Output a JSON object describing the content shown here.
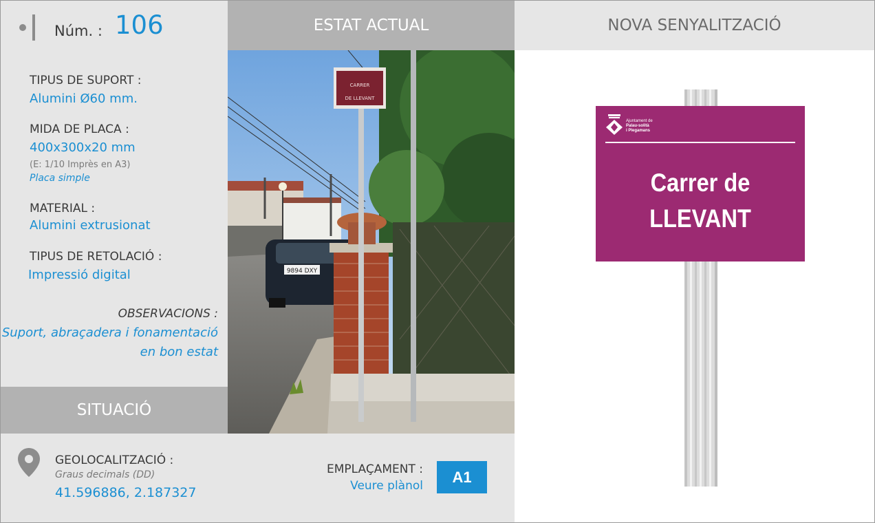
{
  "header": {
    "num_label": "Núm. :",
    "num_value": "106",
    "estat_title": "ESTAT ACTUAL",
    "nova_title": "NOVA SENYALITZACIÓ"
  },
  "info": {
    "suport_label": "TIPUS DE SUPORT :",
    "suport_value": "Alumini Ø60 mm.",
    "mida_label": "MIDA DE PLACA :",
    "mida_value": "400x300x20 mm",
    "mida_scale": "(E: 1/10 Imprès en A3)",
    "mida_type": "Placa simple",
    "material_label": "MATERIAL :",
    "material_value": "Alumini extrusionat",
    "retolacio_label": "TIPUS DE RETOLACIÓ :",
    "retolacio_value": "Impressió digital",
    "observacions_label": "OBSERVACIONS :",
    "observacions_value": "Suport, abraçadera i fonamentació en bon estat"
  },
  "situacio": {
    "title": "SITUACIÓ",
    "geo_label": "GEOLOCALITZACIÓ :",
    "geo_sub": "Graus decimals (DD)",
    "geo_value": "41.596886, 2.187327",
    "emp_label": "EMPLAÇAMENT :",
    "emp_value": "Veure plànol",
    "emp_code": "A1"
  },
  "photo": {
    "sign_line1": "CARRER",
    "sign_line2": "DE LLEVANT",
    "plate_number": "9894 DXY"
  },
  "new_sign": {
    "org_line1": "Ajuntament de",
    "org_line2": "Palau-solità",
    "org_line3": "i Plegamans",
    "text_line1": "Carrer de",
    "text_line2": "LLEVANT",
    "plate_color": "#9c2a72"
  },
  "colors": {
    "accent": "#1b8fd2",
    "header_dark": "#b2b2b2",
    "panel_light": "#e6e6e6"
  }
}
